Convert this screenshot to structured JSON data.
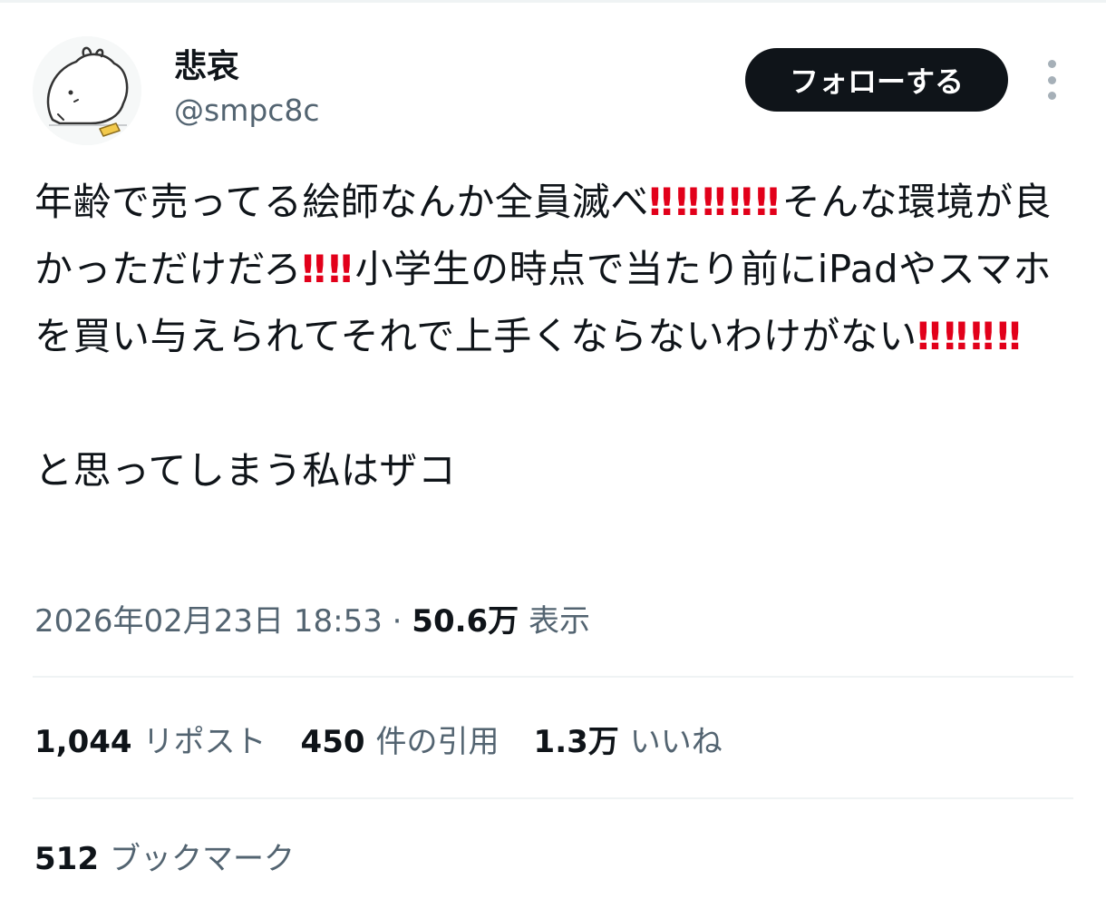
{
  "user": {
    "display_name": "悲哀",
    "handle": "@smpc8c"
  },
  "header": {
    "follow_label": "フォローする"
  },
  "tweet": {
    "line1": "年齢で売ってる絵師なんか全員滅べ",
    "line2": "そんな環境が良かっただけだろ",
    "line3": "小学生の時点で当たり前にiPadやスマホを買い与えられてそれで上手くならないわけがない",
    "line4": "と思ってしまう私はザコ",
    "emphasis": "‼"
  },
  "meta": {
    "timestamp": "2026年02月23日 18:53",
    "separator": "·",
    "views_count": "50.6万",
    "views_label": "表示"
  },
  "stats": {
    "reposts_count": "1,044",
    "reposts_label": "リポスト",
    "quotes_count": "450",
    "quotes_label": "件の引用",
    "likes_count": "1.3万",
    "likes_label": "いいね",
    "bookmarks_count": "512",
    "bookmarks_label": "ブックマーク"
  },
  "colors": {
    "text": "#0f1419",
    "secondary": "#536471",
    "emphasis": "#e2001a",
    "divider": "#eff3f4",
    "follow_bg": "#0f1419"
  },
  "icons": {
    "more": "more-vertical-icon",
    "emphasis": "double-exclamation-icon"
  }
}
